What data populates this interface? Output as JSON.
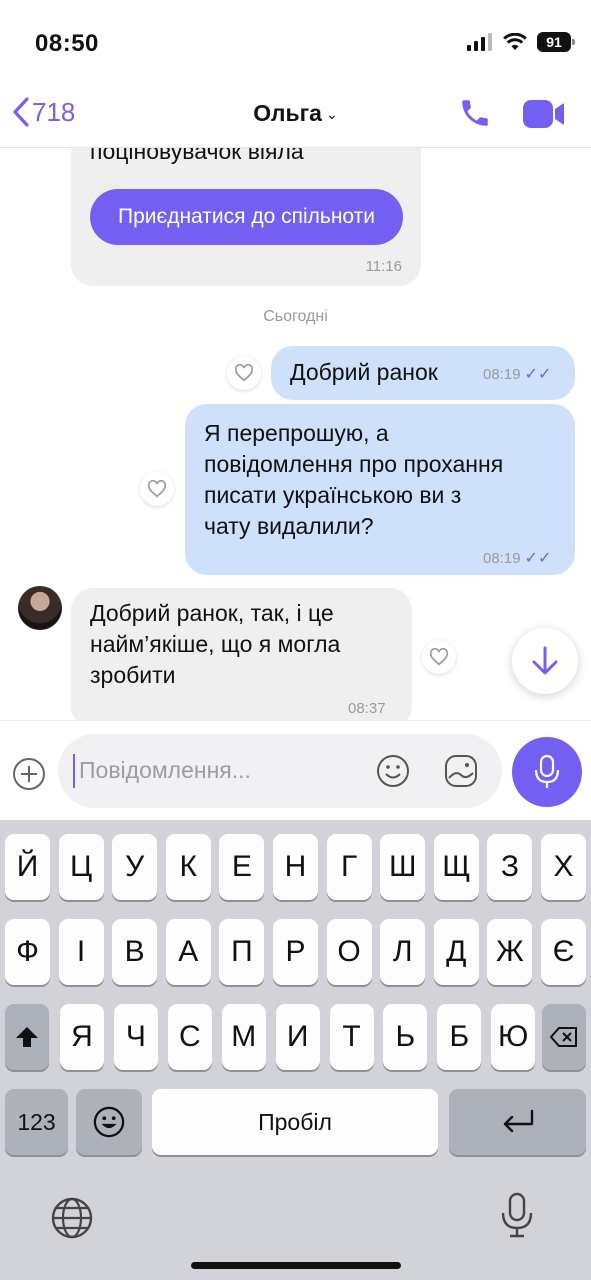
{
  "status_bar": {
    "time": "08:50",
    "battery": "91"
  },
  "header": {
    "back_count": "718",
    "contact_name": "Ольга",
    "chevron": "⌄"
  },
  "colors": {
    "accent": "#7360f2",
    "outgoing_bubble": "#cfe0fb",
    "incoming_bubble": "#efefef"
  },
  "chat": {
    "prev_message": {
      "partial_text": "поціновувачок віяла",
      "button_label": "Приєднатися до спільноти",
      "time": "11:16"
    },
    "date_separator": "Сьогодні",
    "messages": [
      {
        "direction": "out",
        "text": "Добрий ранок",
        "time": "08:19"
      },
      {
        "direction": "out",
        "lines": [
          "Я перепрошую, а",
          "повідомлення про прохання",
          "писати українською ви з",
          "чату видалили?"
        ],
        "time": "08:19"
      },
      {
        "direction": "in",
        "lines": [
          "Добрий ранок, так, і це",
          "найм’якіше, що я могла",
          "зробити"
        ],
        "time": "08:37"
      }
    ]
  },
  "input": {
    "placeholder": "Повідомлення..."
  },
  "keyboard": {
    "row1": [
      "Й",
      "Ц",
      "У",
      "К",
      "Е",
      "Н",
      "Г",
      "Ш",
      "Щ",
      "З",
      "Х"
    ],
    "row2": [
      "Ф",
      "І",
      "В",
      "А",
      "П",
      "Р",
      "О",
      "Л",
      "Д",
      "Ж",
      "Є"
    ],
    "row3": [
      "Я",
      "Ч",
      "С",
      "М",
      "И",
      "Т",
      "Ь",
      "Б",
      "Ю"
    ],
    "numbers_key": "123",
    "space_key": "Пробіл"
  }
}
